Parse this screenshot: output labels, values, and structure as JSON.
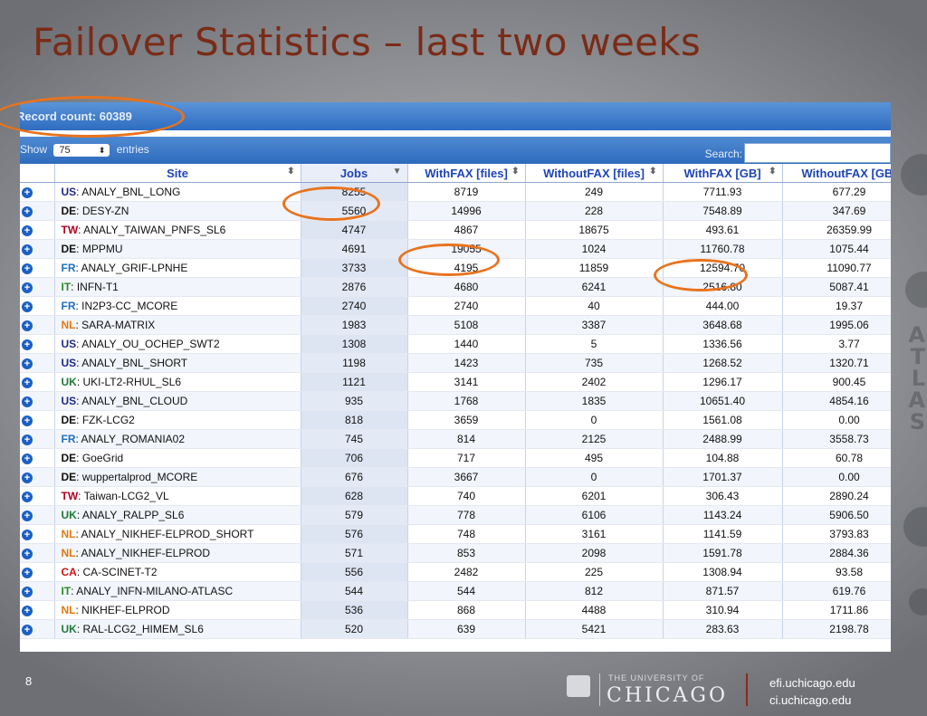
{
  "slide": {
    "title": "Failover Statistics – last two weeks",
    "page_number": "8"
  },
  "footer": {
    "university_small": "THE UNIVERSITY OF",
    "university_big": "CHICAGO",
    "url1": "efi.uchicago.edu",
    "url2": "ci.uchicago.edu"
  },
  "table_ui": {
    "record_count": "Record count: 60389",
    "show_label": "Show",
    "entries_value": "75",
    "entries_label": "entries",
    "search_label": "Search:",
    "search_value": ""
  },
  "columns": [
    "Site",
    "Jobs",
    "WithFAX [files]",
    "WithoutFAX [files]",
    "WithFAX [GB]",
    "WithoutFAX [GB]"
  ],
  "rows": [
    {
      "cc": "US",
      "ccColor": "#1f2a8a",
      "site": "ANALY_BNL_LONG",
      "jobs": "8255",
      "wf": "8719",
      "wof": "249",
      "wgb": "7711.93",
      "wogb": "677.29"
    },
    {
      "cc": "DE",
      "ccColor": "#111111",
      "site": "DESY-ZN",
      "jobs": "5560",
      "wf": "14996",
      "wof": "228",
      "wgb": "7548.89",
      "wogb": "347.69"
    },
    {
      "cc": "TW",
      "ccColor": "#b00020",
      "site": "ANALY_TAIWAN_PNFS_SL6",
      "jobs": "4747",
      "wf": "4867",
      "wof": "18675",
      "wgb": "493.61",
      "wogb": "26359.99"
    },
    {
      "cc": "DE",
      "ccColor": "#111111",
      "site": "MPPMU",
      "jobs": "4691",
      "wf": "19055",
      "wof": "1024",
      "wgb": "11760.78",
      "wogb": "1075.44"
    },
    {
      "cc": "FR",
      "ccColor": "#1f6fbf",
      "site": "ANALY_GRIF-LPNHE",
      "jobs": "3733",
      "wf": "4195",
      "wof": "11859",
      "wgb": "12594.70",
      "wogb": "11090.77"
    },
    {
      "cc": "IT",
      "ccColor": "#2a8a2a",
      "site": "INFN-T1",
      "jobs": "2876",
      "wf": "4680",
      "wof": "6241",
      "wgb": "2516.80",
      "wogb": "5087.41"
    },
    {
      "cc": "FR",
      "ccColor": "#1f6fbf",
      "site": "IN2P3-CC_MCORE",
      "jobs": "2740",
      "wf": "2740",
      "wof": "40",
      "wgb": "444.00",
      "wogb": "19.37"
    },
    {
      "cc": "NL",
      "ccColor": "#e07a10",
      "site": "SARA-MATRIX",
      "jobs": "1983",
      "wf": "5108",
      "wof": "3387",
      "wgb": "3648.68",
      "wogb": "1995.06"
    },
    {
      "cc": "US",
      "ccColor": "#1f2a8a",
      "site": "ANALY_OU_OCHEP_SWT2",
      "jobs": "1308",
      "wf": "1440",
      "wof": "5",
      "wgb": "1336.56",
      "wogb": "3.77"
    },
    {
      "cc": "US",
      "ccColor": "#1f2a8a",
      "site": "ANALY_BNL_SHORT",
      "jobs": "1198",
      "wf": "1423",
      "wof": "735",
      "wgb": "1268.52",
      "wogb": "1320.71"
    },
    {
      "cc": "UK",
      "ccColor": "#1e7a3a",
      "site": "UKI-LT2-RHUL_SL6",
      "jobs": "1121",
      "wf": "3141",
      "wof": "2402",
      "wgb": "1296.17",
      "wogb": "900.45"
    },
    {
      "cc": "US",
      "ccColor": "#1f2a8a",
      "site": "ANALY_BNL_CLOUD",
      "jobs": "935",
      "wf": "1768",
      "wof": "1835",
      "wgb": "10651.40",
      "wogb": "4854.16"
    },
    {
      "cc": "DE",
      "ccColor": "#111111",
      "site": "FZK-LCG2",
      "jobs": "818",
      "wf": "3659",
      "wof": "0",
      "wgb": "1561.08",
      "wogb": "0.00"
    },
    {
      "cc": "FR",
      "ccColor": "#1f6fbf",
      "site": "ANALY_ROMANIA02",
      "jobs": "745",
      "wf": "814",
      "wof": "2125",
      "wgb": "2488.99",
      "wogb": "3558.73"
    },
    {
      "cc": "DE",
      "ccColor": "#111111",
      "site": "GoeGrid",
      "jobs": "706",
      "wf": "717",
      "wof": "495",
      "wgb": "104.88",
      "wogb": "60.78"
    },
    {
      "cc": "DE",
      "ccColor": "#111111",
      "site": "wuppertalprod_MCORE",
      "jobs": "676",
      "wf": "3667",
      "wof": "0",
      "wgb": "1701.37",
      "wogb": "0.00"
    },
    {
      "cc": "TW",
      "ccColor": "#b00020",
      "site": "Taiwan-LCG2_VL",
      "jobs": "628",
      "wf": "740",
      "wof": "6201",
      "wgb": "306.43",
      "wogb": "2890.24"
    },
    {
      "cc": "UK",
      "ccColor": "#1e7a3a",
      "site": "ANALY_RALPP_SL6",
      "jobs": "579",
      "wf": "778",
      "wof": "6106",
      "wgb": "1143.24",
      "wogb": "5906.50"
    },
    {
      "cc": "NL",
      "ccColor": "#e07a10",
      "site": "ANALY_NIKHEF-ELPROD_SHORT",
      "jobs": "576",
      "wf": "748",
      "wof": "3161",
      "wgb": "1141.59",
      "wogb": "3793.83"
    },
    {
      "cc": "NL",
      "ccColor": "#e07a10",
      "site": "ANALY_NIKHEF-ELPROD",
      "jobs": "571",
      "wf": "853",
      "wof": "2098",
      "wgb": "1591.78",
      "wogb": "2884.36"
    },
    {
      "cc": "CA",
      "ccColor": "#d01010",
      "site": "CA-SCINET-T2",
      "jobs": "556",
      "wf": "2482",
      "wof": "225",
      "wgb": "1308.94",
      "wogb": "93.58"
    },
    {
      "cc": "IT",
      "ccColor": "#2a8a2a",
      "site": "ANALY_INFN-MILANO-ATLASC",
      "jobs": "544",
      "wf": "544",
      "wof": "812",
      "wgb": "871.57",
      "wogb": "619.76"
    },
    {
      "cc": "NL",
      "ccColor": "#e07a10",
      "site": "NIKHEF-ELPROD",
      "jobs": "536",
      "wf": "868",
      "wof": "4488",
      "wgb": "310.94",
      "wogb": "1711.86"
    },
    {
      "cc": "UK",
      "ccColor": "#1e7a3a",
      "site": "RAL-LCG2_HIMEM_SL6",
      "jobs": "520",
      "wf": "639",
      "wof": "5421",
      "wgb": "283.63",
      "wogb": "2198.78"
    }
  ],
  "colors": {
    "title": "#7a2b17",
    "highlight": "#e8731e",
    "header_blue": "#2e6cc0"
  },
  "decor": {
    "atlas_letters": [
      "A",
      "T",
      "L",
      "A",
      "S"
    ]
  }
}
